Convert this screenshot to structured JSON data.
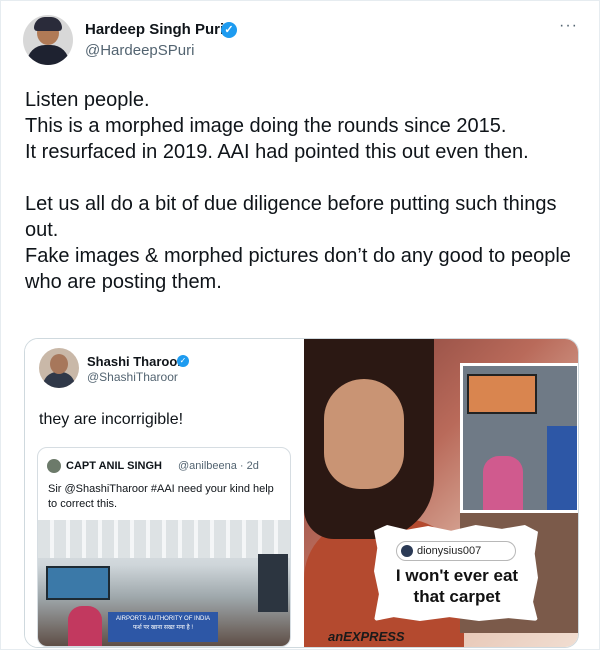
{
  "author": {
    "name": "Hardeep Singh Puri",
    "handle": "@HardeepSPuri",
    "verified_icon": "verified-badge-icon",
    "more_icon": "more-options-icon"
  },
  "tweet": {
    "lines": [
      "Listen people.",
      "This is a morphed image doing the rounds since 2015.",
      "It resurfaced in 2019. AAI had pointed this out even then.",
      "",
      "Let us all do a bit of due diligence before putting such things out.",
      "Fake images & morphed pictures don’t do any good to people who are posting them."
    ]
  },
  "media": {
    "left": {
      "name": "Shashi Tharoor",
      "handle": "@ShashiTharoor",
      "text": "they are incorrigible!",
      "quote": {
        "name": "CAPT ANIL SINGH",
        "handle": "@anilbeena · 2d",
        "text": "Sir @ShashiTharoor #AAI need your kind help to correct this.",
        "sign_line1": "AIRPORTS AUTHORITY OF INDIA",
        "sign_line2": "फर्श पर खाना सख्त मना है !"
      }
    },
    "right": {
      "username": "dionysius007",
      "quip": "I won't ever eat that carpet",
      "brand": "anEXPRESS"
    }
  },
  "colors": {
    "verified": "#1d9bf0",
    "text": "#0f1419",
    "muted": "#536471"
  }
}
